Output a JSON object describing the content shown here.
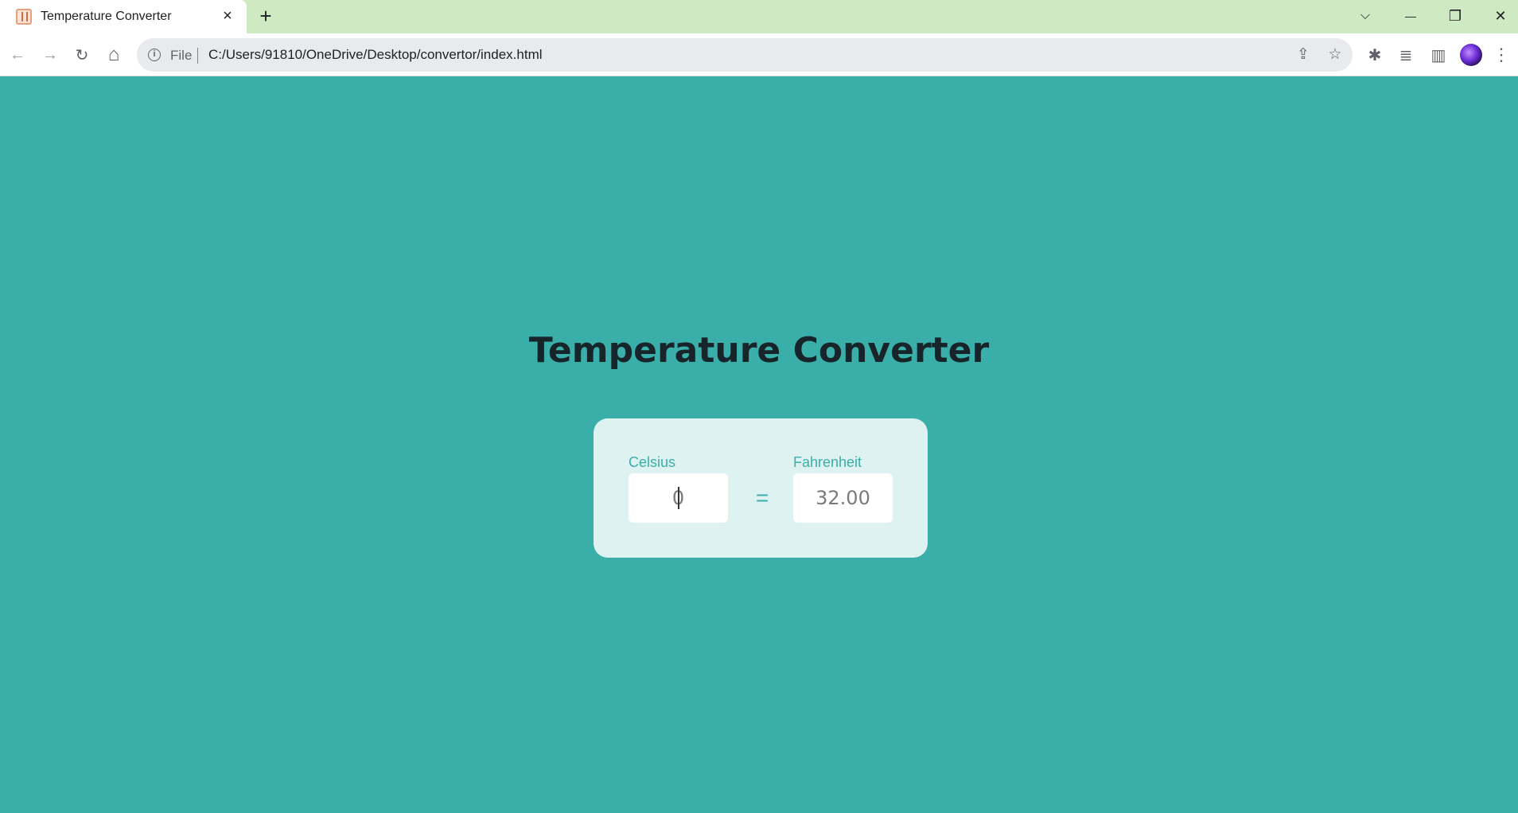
{
  "browser": {
    "tab": {
      "title": "Temperature Converter",
      "favicon": "thermometer-favicon-icon",
      "close_icon": "×"
    },
    "new_tab_icon": "+",
    "window_controls": {
      "tab_search": "⌵",
      "minimize": "—",
      "restore": "❐",
      "close": "✕"
    },
    "toolbar": {
      "back": "←",
      "forward": "→",
      "reload": "↻",
      "home": "⌂",
      "site_info": "i",
      "file_label": "File",
      "url": "C:/Users/91810/OneDrive/Desktop/convertor/index.html",
      "share": "⇪",
      "bookmark": "☆",
      "extensions": "✱",
      "media": "≣",
      "side_panel": "▥",
      "menu": "⋮"
    },
    "colors": {
      "tabstrip": "#cfe9c2",
      "page_background": "#3aafa9",
      "card_background": "#def2f1",
      "accent": "#3aafa9",
      "heading": "#17252a"
    }
  },
  "page": {
    "heading": "Temperature Converter",
    "converter": {
      "celsius_label": "Celsius",
      "celsius_value": "0",
      "equals_sign": "=",
      "fahrenheit_label": "Fahrenheit",
      "fahrenheit_value": "32.00"
    }
  }
}
